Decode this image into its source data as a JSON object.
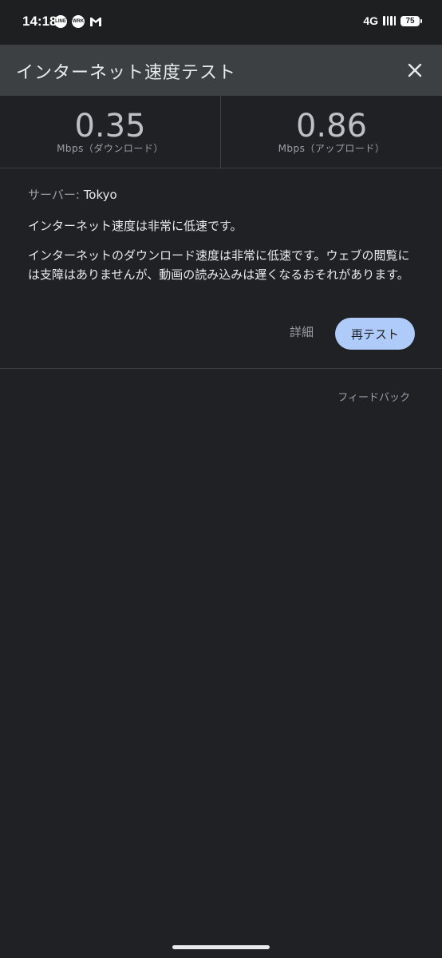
{
  "status_bar": {
    "time": "14:18",
    "notification_icons": [
      "line-icon",
      "line-works-icon",
      "gmail-icon"
    ],
    "network": "4G",
    "battery": "75"
  },
  "toolbar": {
    "title": "インターネット速度テスト",
    "close_icon": "close-icon"
  },
  "speed": {
    "download": {
      "value": "0.35",
      "unit": "Mbps（ダウンロード）"
    },
    "upload": {
      "value": "0.86",
      "unit": "Mbps（アップロード）"
    }
  },
  "info": {
    "server_label": "サーバー: ",
    "server_value": "Tokyo",
    "summary": "インターネット速度は非常に低速です。",
    "detail": "インターネットのダウンロード速度は非常に低速です。ウェブの閲覧には支障はありませんが、動画の読み込みは遅くなるおそれがあります。"
  },
  "actions": {
    "details_label": "詳細",
    "retest_label": "再テスト"
  },
  "feedback_label": "フィードバック",
  "colors": {
    "background": "#202124",
    "toolbar": "#3c4043",
    "accent_button": "#aecbfa"
  }
}
